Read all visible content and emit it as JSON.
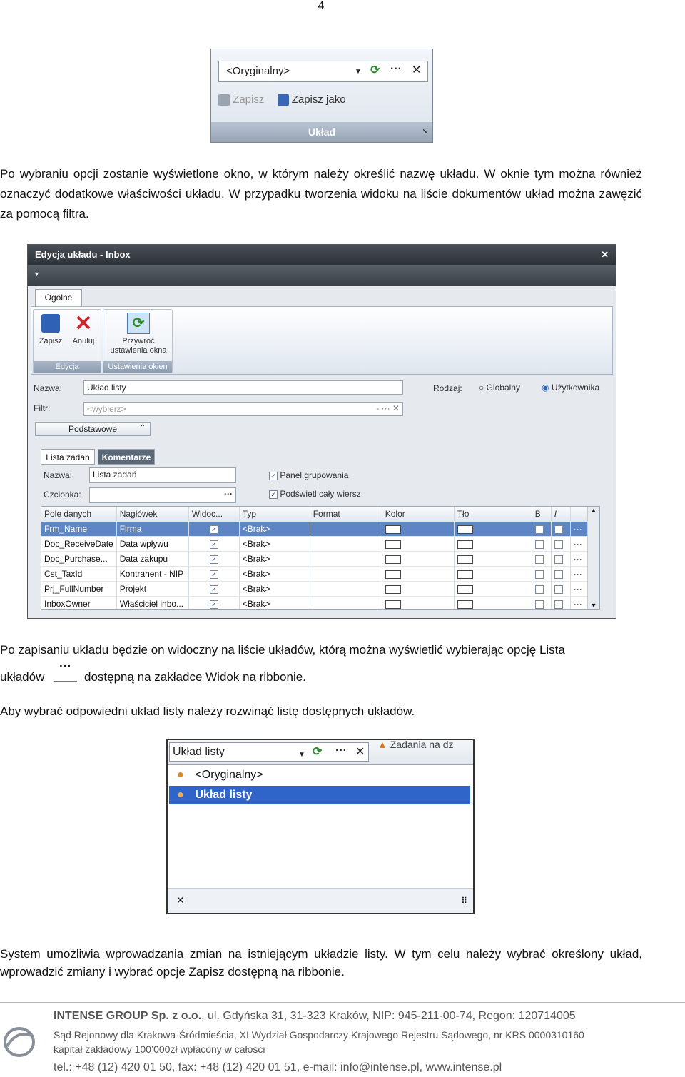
{
  "page_number": "4",
  "shot1": {
    "combo_value": "<Oryginalny>",
    "save_label": "Zapisz",
    "save_as_label": "Zapisz jako",
    "group_label": "Układ"
  },
  "para1": "Po wybraniu opcji zostanie wyświetlone okno, w którym należy określić nazwę układu. W oknie tym można również oznaczyć dodatkowe właściwości układu. W przypadku tworzenia widoku na liście dokumentów układ można zawęzić za pomocą filtra.",
  "dialog": {
    "title": "Edycja układu - Inbox",
    "tab_general": "Ogólne",
    "btn_save": "Zapisz",
    "btn_cancel": "Anuluj",
    "btn_restore_line1": "Przywróć",
    "btn_restore_line2": "ustawienia okna",
    "group_edit": "Edycja",
    "group_window": "Ustawienia okien",
    "label_name": "Nazwa:",
    "name_value": "Układ listy",
    "label_filter": "Filtr:",
    "filter_placeholder": "<wybierz>",
    "label_kind": "Rodzaj:",
    "kind_global": "Globalny",
    "kind_user": "Użytkownika",
    "basic_toggle": "Podstawowe",
    "subtab_tasks": "Lista zadań",
    "subtab_comments": "Komentarze",
    "label_sub_name": "Nazwa:",
    "sub_name_value": "Lista zadań",
    "label_font": "Czcionka:",
    "opt_group_panel": "Panel grupowania",
    "opt_full_row": "Podświetl cały wiersz",
    "columns": [
      "Pole danych",
      "Nagłówek",
      "Widoc...",
      "Typ",
      "Format",
      "Kolor",
      "Tło",
      "B",
      "I"
    ],
    "rows": [
      {
        "field": "Frm_Name",
        "header": "Firma",
        "type": "<Brak>"
      },
      {
        "field": "Doc_ReceiveDate",
        "header": "Data wpływu",
        "type": "<Brak>"
      },
      {
        "field": "Doc_Purchase...",
        "header": "Data zakupu",
        "type": "<Brak>"
      },
      {
        "field": "Cst_TaxId",
        "header": "Kontrahent - NIP",
        "type": "<Brak>"
      },
      {
        "field": "Prj_FullNumber",
        "header": "Projekt",
        "type": "<Brak>"
      },
      {
        "field": "InboxOwner",
        "header": "Właściciel inbo...",
        "type": "<Brak>"
      }
    ]
  },
  "para2_a": "Po zapisaniu układu będzie on widoczny na liście układów, którą można wyświetlić wybierając opcję Lista",
  "para2_b": "układów",
  "para2_c": "dostępną na zakładce Widok na ribbonie.",
  "para3": "Aby wybrać odpowiedni układ listy należy rozwinąć listę dostępnych układów.",
  "shot3": {
    "combo_value": "Układ listy",
    "side_text": "Zadania na dz",
    "items": [
      "<Oryginalny>",
      "Układ listy"
    ]
  },
  "para4": "System umożliwia wprowadzania zmian na istniejącym układzie listy. W tym celu należy wybrać określony układ, wprowadzić zmiany i wybrać opcje Zapisz  dostępną na ribbonie.",
  "footer": {
    "company": "INTENSE GROUP",
    "company_rest": "Sp. z o.o.",
    "address": ", ul. Gdyńska 31, 31-323 Kraków, NIP: 945-211-00-74, Regon: 120714005",
    "court": "Sąd Rejonowy dla Krakowa-Śródmieścia, XI Wydział Gospodarczy Krajowego Rejestru Sądowego, nr KRS 0000310160",
    "capital": "kapitał zakładowy 100’000zł wpłacony w całości",
    "contact": "tel.: +48 (12) 420 01 50, fax: +48 (12) 420 01 51, e-mail: info@intense.pl, www.intense.pl"
  }
}
